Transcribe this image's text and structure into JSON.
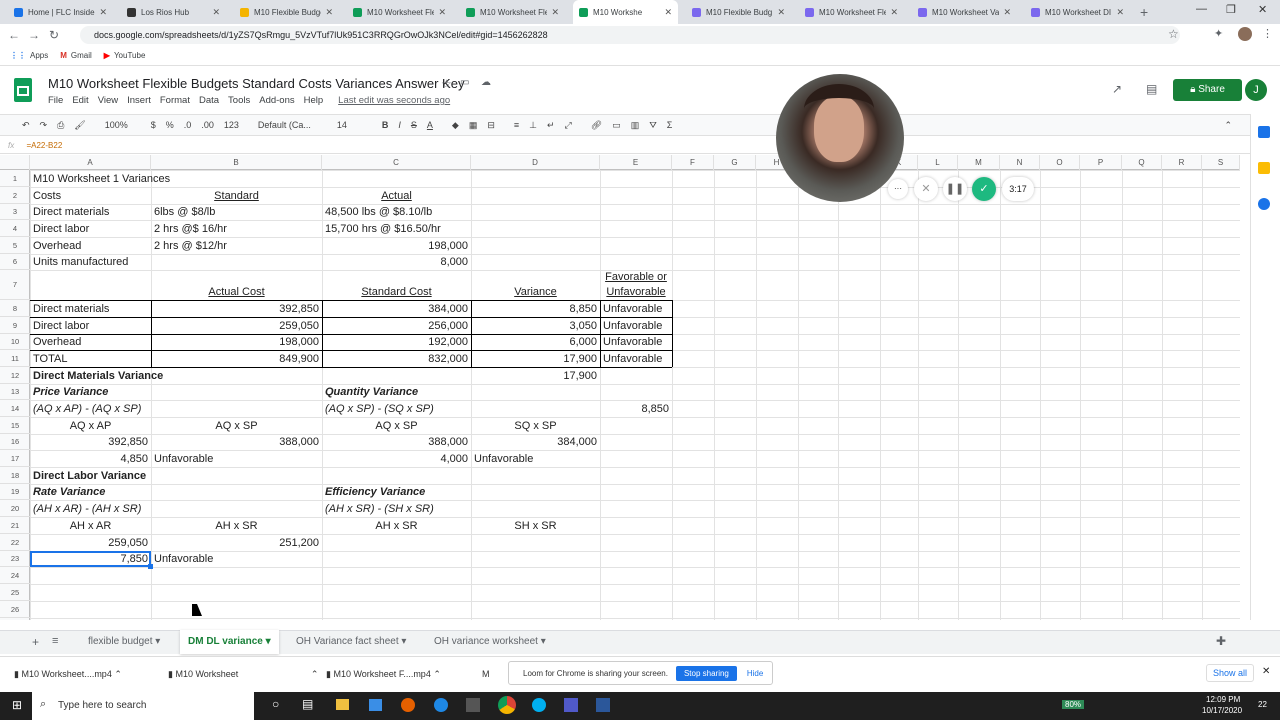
{
  "browser": {
    "tabs": [
      {
        "label": "Home | FLC Inside",
        "icon": "flc-icon",
        "color": "#1a73e8"
      },
      {
        "label": "Los Rios Hub",
        "icon": "github-icon",
        "color": "#333333"
      },
      {
        "label": "M10 Flexible Budge",
        "icon": "drive-icon",
        "color": "#f4b400"
      },
      {
        "label": "M10 Worksheet Fle",
        "icon": "sheets-icon",
        "color": "#0f9d58"
      },
      {
        "label": "M10 Worksheet Fle",
        "icon": "sheets-icon",
        "color": "#0f9d58"
      },
      {
        "label": "M10 Workshe",
        "icon": "sheets-icon",
        "color": "#0f9d58"
      },
      {
        "label": "M10 Flexible Budg",
        "icon": "settings-icon",
        "color": "#7b68ee"
      },
      {
        "label": "M10 Worksheet Fle",
        "icon": "settings-icon",
        "color": "#7b68ee"
      },
      {
        "label": "M10 Worksheet Va",
        "icon": "settings-icon",
        "color": "#7b68ee"
      },
      {
        "label": "M10 Worksheet DI",
        "icon": "settings-icon",
        "color": "#7b68ee"
      }
    ],
    "url": "docs.google.com/spreadsheets/d/1yZS7QsRmgu_5VzVTuf7lUk951C3RRQGrOwOJk3NCel/edit#gid=1456262828",
    "bookmarks": [
      "Apps",
      "Gmail",
      "YouTube"
    ]
  },
  "doc": {
    "title": "M10 Worksheet Flexible Budgets Standard Costs Variances Answer Key",
    "menu": [
      "File",
      "Edit",
      "View",
      "Insert",
      "Format",
      "Data",
      "Tools",
      "Add-ons",
      "Help"
    ],
    "last_edit": "Last edit was seconds ago",
    "share_label": "Share",
    "avatar_letter": "J"
  },
  "toolbar": {
    "zoom": "100%",
    "currency": "$",
    "percent": "%",
    "dec_less": ".0",
    "dec_more": ".00",
    "format_more": "123",
    "font": "Default (Ca...",
    "font_size": "14",
    "bold": "B",
    "italic": "I",
    "strike": "S",
    "text_color": "A"
  },
  "formula_bar": {
    "fx": "fx",
    "content": "=A22-B22"
  },
  "loom": {
    "timer": "3:17",
    "more": "···"
  },
  "columns": [
    "A",
    "B",
    "C",
    "D",
    "E",
    "F",
    "G",
    "H",
    "I",
    "J",
    "K",
    "L",
    "M",
    "N",
    "O",
    "P",
    "Q",
    "R",
    "S"
  ],
  "rows": [
    "1",
    "2",
    "3",
    "4",
    "5",
    "6",
    "7",
    "8",
    "9",
    "10",
    "11",
    "12",
    "13",
    "14",
    "15",
    "16",
    "17",
    "18",
    "19",
    "20",
    "21",
    "22",
    "23",
    "24",
    "25",
    "26"
  ],
  "cells": {
    "r1": {
      "a": "M10 Worksheet 1 Variances"
    },
    "r2": {
      "a": "Costs",
      "b": "Standard",
      "c": "Actual"
    },
    "r3": {
      "a": "Direct materials",
      "b": "6lbs @ $8/lb",
      "c": "48,500 lbs @ $8.10/lb"
    },
    "r4": {
      "a": "Direct labor",
      "b": "2 hrs @$ 16/hr",
      "c": "15,700 hrs @ $16.50/hr"
    },
    "r5": {
      "a": "Overhead",
      "b": "2 hrs @ $12/hr",
      "c": "198,000"
    },
    "r6": {
      "a": "Units manufactured",
      "c": "8,000"
    },
    "r7": {
      "b": "Actual Cost",
      "c": "Standard Cost",
      "d": "Variance",
      "e1": "Favorable or",
      "e2": "Unfavorable"
    },
    "r8": {
      "a": "Direct materials",
      "b": "392,850",
      "c": "384,000",
      "d": "8,850",
      "e": "Unfavorable"
    },
    "r9": {
      "a": "Direct labor",
      "b": "259,050",
      "c": "256,000",
      "d": "3,050",
      "e": "Unfavorable"
    },
    "r10": {
      "a": "Overhead",
      "b": "198,000",
      "c": "192,000",
      "d": "6,000",
      "e": "Unfavorable"
    },
    "r11": {
      "a": "TOTAL",
      "b": "849,900",
      "c": "832,000",
      "d": "17,900",
      "e": "Unfavorable"
    },
    "r12": {
      "a": "Direct Materials Variance",
      "d": "17,900"
    },
    "r13": {
      "a": "Price Variance",
      "c": "Quantity Variance"
    },
    "r14": {
      "a": "(AQ x AP) - (AQ x SP)",
      "c": "(AQ x SP) - (SQ x SP)",
      "e": "8,850"
    },
    "r15": {
      "a": "AQ x AP",
      "b": "AQ x SP",
      "c": "AQ x SP",
      "d": "SQ x SP"
    },
    "r16": {
      "a": "392,850",
      "b": "388,000",
      "c": "388,000",
      "d": "384,000"
    },
    "r17": {
      "a": "4,850",
      "b": "Unfavorable",
      "c": "4,000",
      "d": "Unfavorable"
    },
    "r18": {
      "a": "Direct Labor Variance"
    },
    "r19": {
      "a": "Rate Variance",
      "c": "Efficiency Variance"
    },
    "r20": {
      "a": "(AH x AR) - (AH x SR)",
      "c": "(AH x SR) - (SH x SR)"
    },
    "r21": {
      "a": "AH x AR",
      "b": "AH x SR",
      "c": "AH x SR",
      "d": "SH x SR"
    },
    "r22": {
      "a": "259,050",
      "b": "251,200"
    },
    "r23": {
      "a": "7,850",
      "b": "Unfavorable"
    }
  },
  "sheet_tabs": [
    "flexible budget",
    "DM DL variance",
    "OH Variance fact sheet",
    "OH variance worksheet"
  ],
  "downloads": [
    "M10 Worksheet....mp4",
    "M10 Worksheet",
    "M10 Worksheet F....mp4",
    "M"
  ],
  "loom_bar": {
    "message": "Loom for Chrome is sharing your screen.",
    "stop": "Stop sharing",
    "hide": "Hide"
  },
  "show_all": "Show all",
  "taskbar": {
    "search": "Type here to search",
    "battery": "80%",
    "time": "12:09 PM",
    "date": "10/17/2020",
    "notif": "22"
  }
}
